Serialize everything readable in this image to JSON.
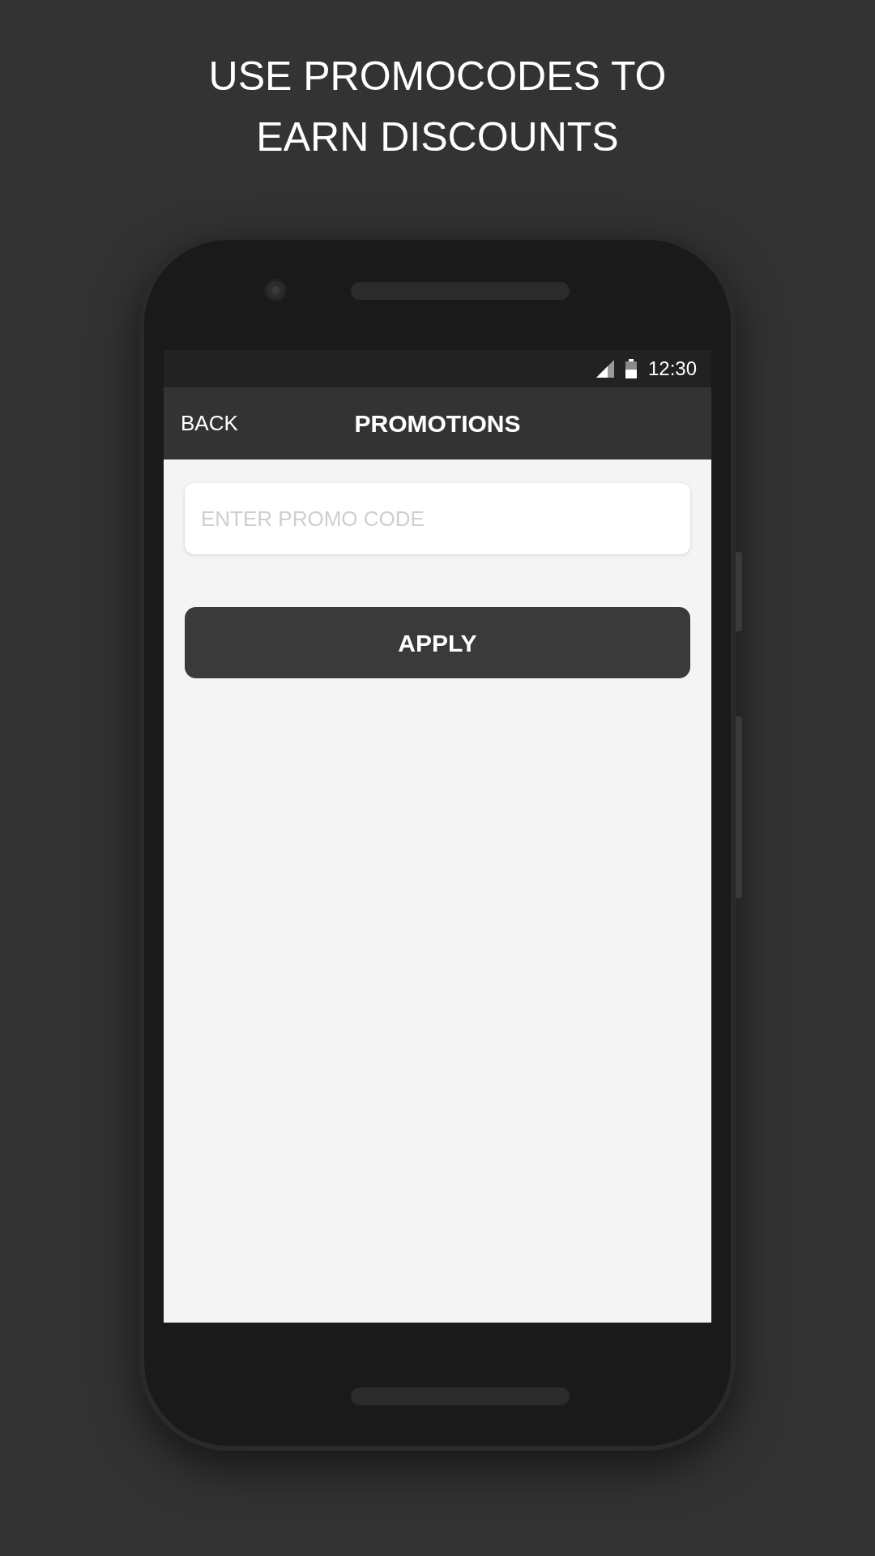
{
  "headline": [
    "USE PROMOCODES TO",
    "EARN DISCOUNTS"
  ],
  "status_bar": {
    "time": "12:30"
  },
  "app_bar": {
    "back": "BACK",
    "title": "PROMOTIONS"
  },
  "promo_field": {
    "placeholder": "ENTER PROMO CODE"
  },
  "apply_button": {
    "label": "APPLY"
  }
}
